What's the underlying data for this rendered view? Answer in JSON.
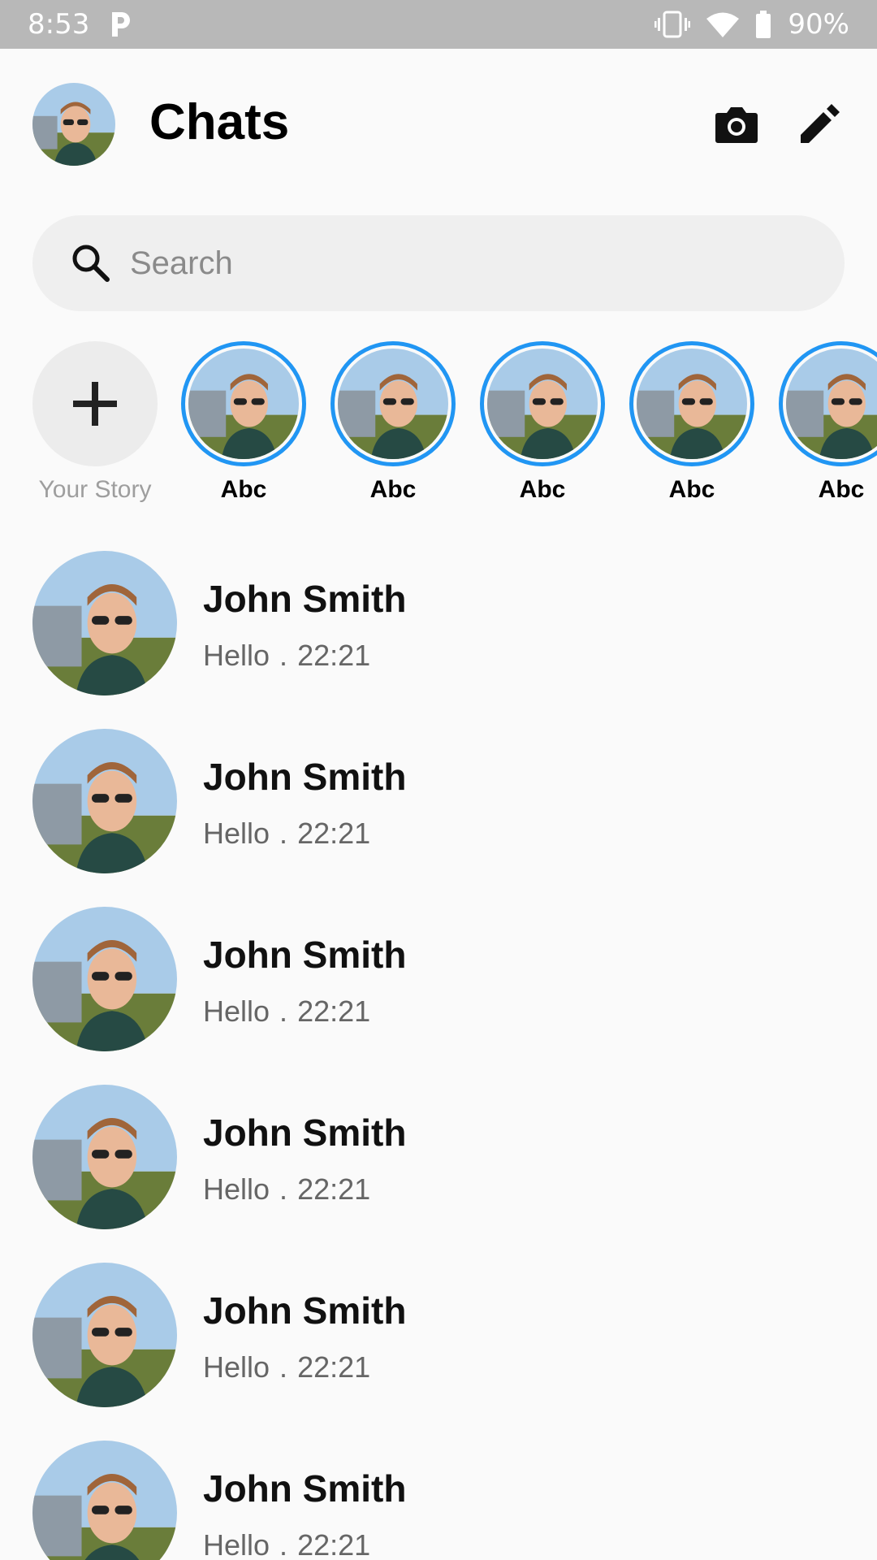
{
  "status_bar": {
    "time": "8:53",
    "battery": "90%",
    "icons": [
      "p-app-icon",
      "vibrate-icon",
      "wifi-icon",
      "battery-icon"
    ]
  },
  "header": {
    "title": "Chats",
    "icons": [
      "profile-avatar",
      "camera-icon",
      "edit-icon"
    ]
  },
  "search": {
    "placeholder": "Search",
    "value": ""
  },
  "stories": {
    "your_story_label": "Your Story",
    "items": [
      {
        "name": "Abc"
      },
      {
        "name": "Abc"
      },
      {
        "name": "Abc"
      },
      {
        "name": "Abc"
      },
      {
        "name": "Abc"
      }
    ]
  },
  "chats": [
    {
      "name": "John Smith",
      "message": "Hello",
      "separator": ".",
      "time": "22:21"
    },
    {
      "name": "John Smith",
      "message": "Hello",
      "separator": ".",
      "time": "22:21"
    },
    {
      "name": "John Smith",
      "message": "Hello",
      "separator": ".",
      "time": "22:21"
    },
    {
      "name": "John Smith",
      "message": "Hello",
      "separator": ".",
      "time": "22:21"
    },
    {
      "name": "John Smith",
      "message": "Hello",
      "separator": ".",
      "time": "22:21"
    },
    {
      "name": "John Smith",
      "message": "Hello",
      "separator": ".",
      "time": "22:21"
    }
  ],
  "colors": {
    "story_ring": "#2196f3",
    "background": "#fafafa",
    "status_bar": "#b8b8b8"
  }
}
